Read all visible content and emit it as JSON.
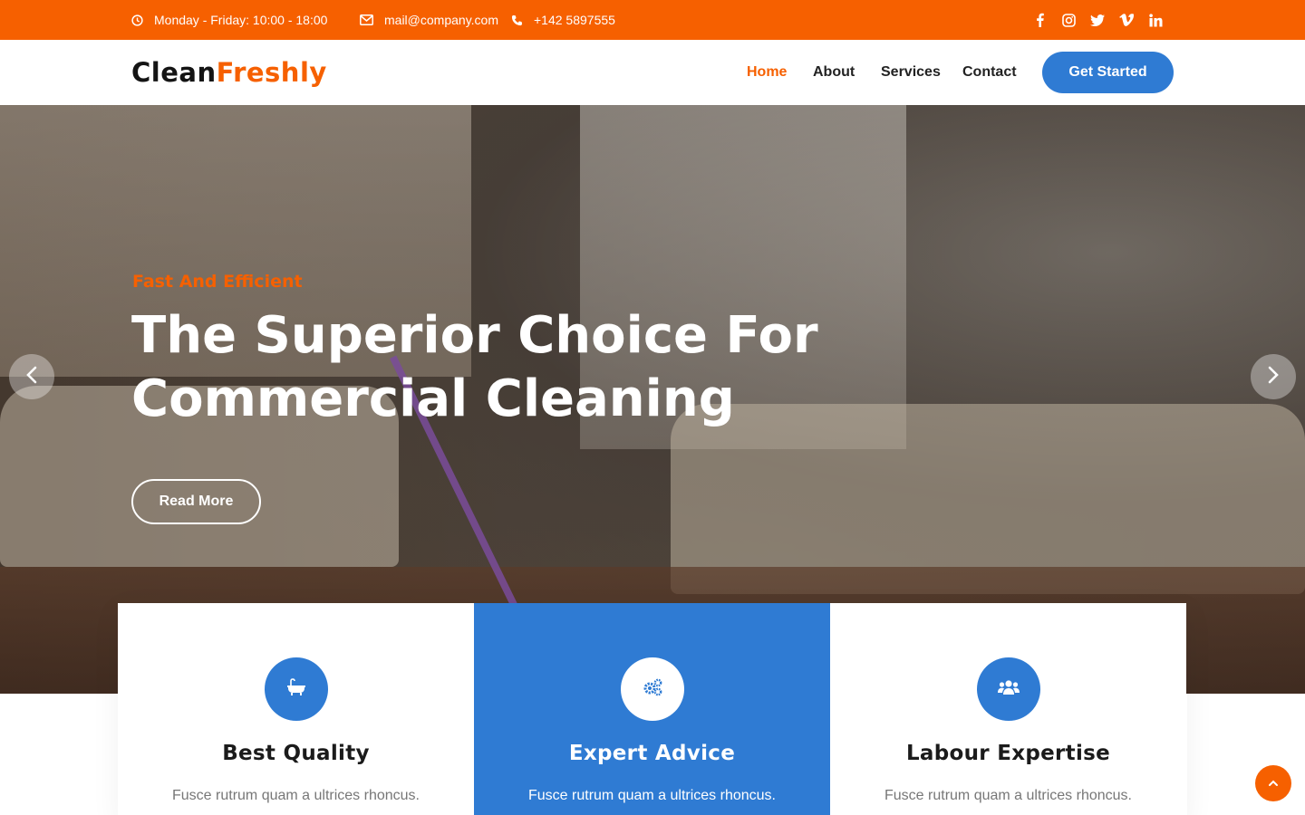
{
  "topbar": {
    "hours": "Monday - Friday: 10:00 - 18:00",
    "email": "mail@company.com",
    "phone": "+142 5897555",
    "social": [
      "facebook-icon",
      "instagram-icon",
      "twitter-icon",
      "vimeo-icon",
      "linkedin-icon"
    ]
  },
  "header": {
    "logo_part1": "Clean",
    "logo_part2": "Freshly",
    "nav": [
      "Home",
      "About",
      "Services",
      "Contact"
    ],
    "active_nav": "Home",
    "cta": "Get Started"
  },
  "hero": {
    "subtitle": "Fast And Efficient",
    "title_line1": "The Superior Choice For",
    "title_line2": "Commercial Cleaning",
    "button": "Read More"
  },
  "features": [
    {
      "icon": "bathtub-icon",
      "title": "Best Quality",
      "text": "Fusce rutrum quam a ultrices rhoncus."
    },
    {
      "icon": "cogs-icon",
      "title": "Expert Advice",
      "text": "Fusce rutrum quam a ultrices rhoncus."
    },
    {
      "icon": "users-icon",
      "title": "Labour Expertise",
      "text": "Fusce rutrum quam a ultrices rhoncus."
    }
  ],
  "colors": {
    "accent": "#f66000",
    "primary": "#2f7bd3",
    "text_dark": "#1b1b1b"
  }
}
